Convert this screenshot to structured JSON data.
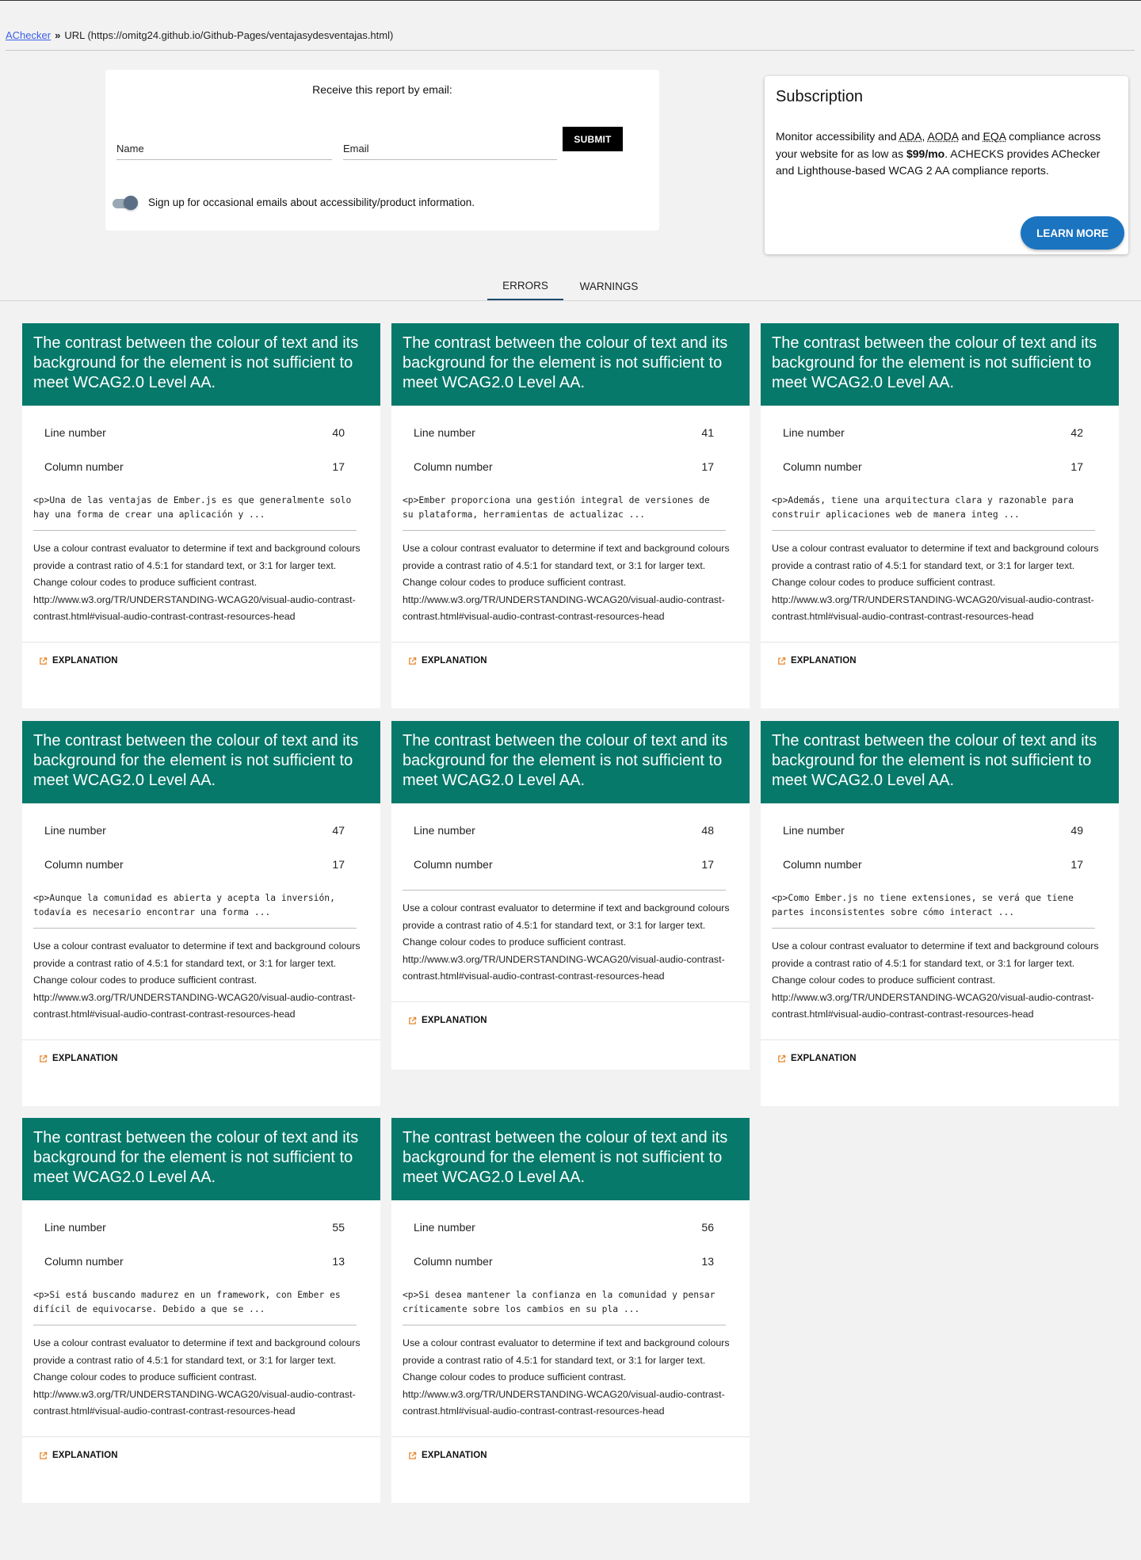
{
  "breadcrumb": {
    "home": "AChecker",
    "separator": "»",
    "url_text": "URL (https://omitg24.github.io/Github-Pages/ventajasydesventajas.html)"
  },
  "email_form": {
    "heading": "Receive this report by email:",
    "name_label": "Name",
    "email_label": "Email",
    "submit_label": "SUBMIT",
    "toggle_label": "Sign up for occasional emails about accessibility/product information."
  },
  "subscription": {
    "title": "Subscription",
    "text_1": "Monitor accessibility and ",
    "abbr_ada": "ADA",
    "text_2": ", ",
    "abbr_aoda": "AODA",
    "text_3": " and ",
    "abbr_eqa": "EQA",
    "text_4": " compliance across your website for as low as ",
    "price": "$99/mo",
    "text_5": ". ACHECKS provides AChecker and Lighthouse-based WCAG 2 AA compliance reports.",
    "button": "LEARN MORE"
  },
  "tabs": {
    "errors": "ERRORS",
    "warnings": "WARNINGS"
  },
  "labels": {
    "line_number": "Line number",
    "column_number": "Column number",
    "explanation": "EXPLANATION"
  },
  "colors": {
    "card_header": "#06796a",
    "learn_more": "#1b74c0",
    "explanation_icon": "#e8862a"
  },
  "cards": [
    {
      "title": "The contrast between the colour of text and its background for the element is not sufficient to meet WCAG2.0 Level AA.",
      "line": "40",
      "column": "17",
      "snippet": "<p>Una de las ventajas de Ember.js es que generalmente solo hay una forma de crear una aplicación y ...",
      "description": "Use a colour contrast evaluator to determine if text and background colours provide a contrast ratio of 4.5:1 for standard text, or 3:1 for larger text. Change colour codes to produce sufficient contrast. http://www.w3.org/TR/UNDERSTANDING-WCAG20/visual-audio-contrast-contrast.html#visual-audio-contrast-contrast-resources-head"
    },
    {
      "title": "The contrast between the colour of text and its background for the element is not sufficient to meet WCAG2.0 Level AA.",
      "line": "41",
      "column": "17",
      "snippet": "<p>Ember proporciona una gestión integral de versiones de su plataforma, herramientas de actualizac ...",
      "description": "Use a colour contrast evaluator to determine if text and background colours provide a contrast ratio of 4.5:1 for standard text, or 3:1 for larger text. Change colour codes to produce sufficient contrast. http://www.w3.org/TR/UNDERSTANDING-WCAG20/visual-audio-contrast-contrast.html#visual-audio-contrast-contrast-resources-head"
    },
    {
      "title": "The contrast between the colour of text and its background for the element is not sufficient to meet WCAG2.0 Level AA.",
      "line": "42",
      "column": "17",
      "snippet": "<p>Además, tiene una arquitectura clara y razonable para construir aplicaciones web de manera integ ...",
      "description": "Use a colour contrast evaluator to determine if text and background colours provide a contrast ratio of 4.5:1 for standard text, or 3:1 for larger text. Change colour codes to produce sufficient contrast. http://www.w3.org/TR/UNDERSTANDING-WCAG20/visual-audio-contrast-contrast.html#visual-audio-contrast-contrast-resources-head"
    },
    {
      "title": "The contrast between the colour of text and its background for the element is not sufficient to meet WCAG2.0 Level AA.",
      "line": "47",
      "column": "17",
      "snippet": "<p>Aunque la comunidad es abierta y acepta la inversión, todavía es necesario encontrar una forma ...",
      "description": "Use a colour contrast evaluator to determine if text and background colours provide a contrast ratio of 4.5:1 for standard text, or 3:1 for larger text. Change colour codes to produce sufficient contrast. http://www.w3.org/TR/UNDERSTANDING-WCAG20/visual-audio-contrast-contrast.html#visual-audio-contrast-contrast-resources-head"
    },
    {
      "title": "The contrast between the colour of text and its background for the element is not sufficient to meet WCAG2.0 Level AA.",
      "line": "48",
      "column": "17",
      "snippet": "",
      "description": "Use a colour contrast evaluator to determine if text and background colours provide a contrast ratio of 4.5:1 for standard text, or 3:1 for larger text. Change colour codes to produce sufficient contrast. http://www.w3.org/TR/UNDERSTANDING-WCAG20/visual-audio-contrast-contrast.html#visual-audio-contrast-contrast-resources-head"
    },
    {
      "title": "The contrast between the colour of text and its background for the element is not sufficient to meet WCAG2.0 Level AA.",
      "line": "49",
      "column": "17",
      "snippet": "<p>Como Ember.js no tiene extensiones, se verá que tiene partes inconsistentes sobre cómo interact ...",
      "description": "Use a colour contrast evaluator to determine if text and background colours provide a contrast ratio of 4.5:1 for standard text, or 3:1 for larger text. Change colour codes to produce sufficient contrast. http://www.w3.org/TR/UNDERSTANDING-WCAG20/visual-audio-contrast-contrast.html#visual-audio-contrast-contrast-resources-head"
    },
    {
      "title": "The contrast between the colour of text and its background for the element is not sufficient to meet WCAG2.0 Level AA.",
      "line": "55",
      "column": "13",
      "snippet": "<p>Si está buscando madurez en un framework, con Ember es difícil de equivocarse. Debido a que se ...",
      "description": "Use a colour contrast evaluator to determine if text and background colours provide a contrast ratio of 4.5:1 for standard text, or 3:1 for larger text. Change colour codes to produce sufficient contrast. http://www.w3.org/TR/UNDERSTANDING-WCAG20/visual-audio-contrast-contrast.html#visual-audio-contrast-contrast-resources-head"
    },
    {
      "title": "The contrast between the colour of text and its background for the element is not sufficient to meet WCAG2.0 Level AA.",
      "line": "56",
      "column": "13",
      "snippet": "<p>Si desea mantener la confianza en la comunidad y pensar críticamente sobre los cambios en su pla ...",
      "description": "Use a colour contrast evaluator to determine if text and background colours provide a contrast ratio of 4.5:1 for standard text, or 3:1 for larger text. Change colour codes to produce sufficient contrast. http://www.w3.org/TR/UNDERSTANDING-WCAG20/visual-audio-contrast-contrast.html#visual-audio-contrast-contrast-resources-head"
    }
  ]
}
